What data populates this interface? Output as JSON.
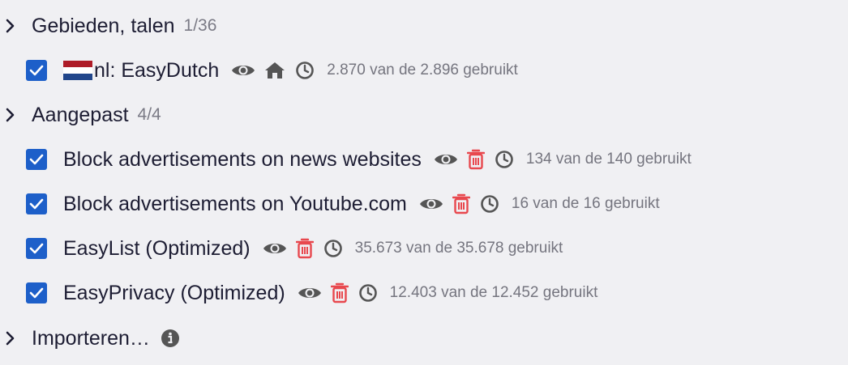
{
  "sections": [
    {
      "title": "Gebieden, talen",
      "count": "1/36",
      "items": [
        {
          "label": "nl: EasyDutch",
          "usage": "2.870 van de 2.896 gebruikt",
          "flag": "netherlands-flag",
          "icons": [
            "eye-icon",
            "home-icon",
            "clock-icon"
          ]
        }
      ]
    },
    {
      "title": "Aangepast",
      "count": "4/4",
      "items": [
        {
          "label": "Block advertisements on news websites",
          "usage": "134 van de 140 gebruikt",
          "icons": [
            "eye-icon",
            "trash-icon",
            "clock-icon"
          ]
        },
        {
          "label": "Block advertisements on Youtube.com",
          "usage": "16 van de 16 gebruikt",
          "icons": [
            "eye-icon",
            "trash-icon",
            "clock-icon"
          ]
        },
        {
          "label": "EasyList (Optimized)",
          "usage": "35.673 van de 35.678 gebruikt",
          "icons": [
            "eye-icon",
            "trash-icon",
            "clock-icon"
          ]
        },
        {
          "label": "EasyPrivacy (Optimized)",
          "usage": "12.403 van de 12.452 gebruikt",
          "icons": [
            "eye-icon",
            "trash-icon",
            "clock-icon"
          ]
        }
      ]
    },
    {
      "title": "Importeren…",
      "icons": [
        "info-icon"
      ]
    }
  ],
  "colors": {
    "checkbox": "#1d5fc9",
    "trash": "#e8484e",
    "icon_gray": "#555555",
    "text": "#1d1d33",
    "muted": "#75757f",
    "background": "#f0f0f3"
  }
}
